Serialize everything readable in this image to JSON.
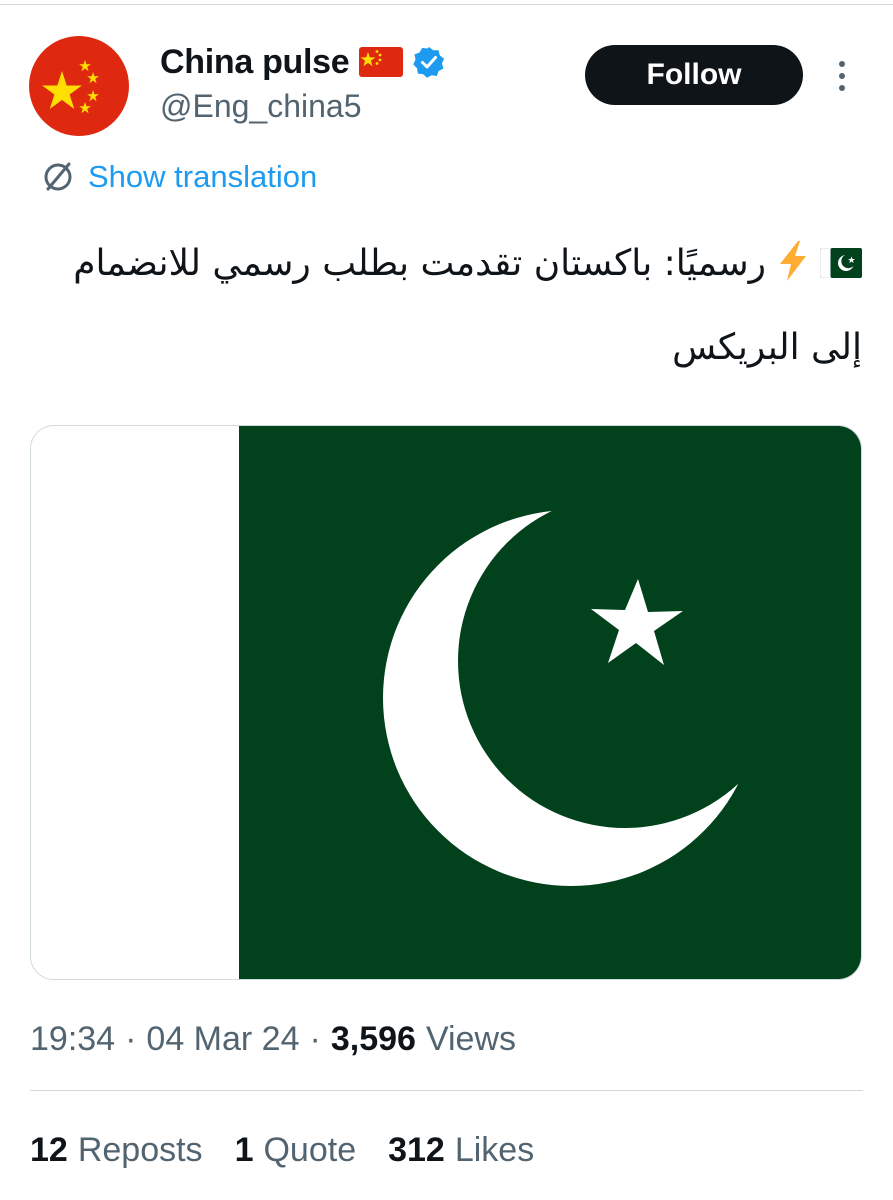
{
  "author": {
    "display_name": "China pulse",
    "handle": "@Eng_china5",
    "avatar_icon": "china-flag-avatar",
    "name_flag_icon": "china-flag-icon",
    "verified_icon": "verified-badge-icon"
  },
  "actions": {
    "follow_label": "Follow",
    "more_icon": "more-options-icon"
  },
  "translation": {
    "label": "Show translation",
    "icon": "translate-icon"
  },
  "tweet": {
    "leading_icons": [
      "pakistan-flag-icon",
      "lightning-icon"
    ],
    "text": "رسميًا: باكستان تقدمت بطلب رسمي للانضمام إلى البريكس"
  },
  "media": {
    "image": "pakistan-flag-image"
  },
  "meta": {
    "time": "19:34",
    "separator": "·",
    "date": "04 Mar 24",
    "views_count": "3,596",
    "views_label": "Views"
  },
  "stats": {
    "reposts_count": "12",
    "reposts_label": "Reposts",
    "quotes_count": "1",
    "quotes_label": "Quote",
    "likes_count": "312",
    "likes_label": "Likes"
  },
  "colors": {
    "text": "#0f1419",
    "secondary": "#536471",
    "link": "#1d9bf0",
    "border": "#cfd9de",
    "pakistan_green": "#01411c",
    "china_red": "#de2910",
    "china_yellow": "#ffde00"
  }
}
